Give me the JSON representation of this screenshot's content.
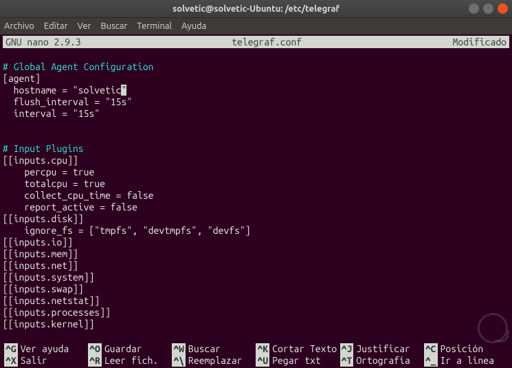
{
  "window": {
    "title": "solvetic@solvetic-Ubuntu: /etc/telegraf"
  },
  "menubar": {
    "items": [
      "Archivo",
      "Editar",
      "Ver",
      "Buscar",
      "Terminal",
      "Ayuda"
    ]
  },
  "nano": {
    "version": "GNU nano 2.9.3",
    "filename": "telegraf.conf",
    "status": "Modificado"
  },
  "editor": {
    "lines": [
      {
        "text": "",
        "cls": ""
      },
      {
        "text": "# Global Agent Configuration",
        "cls": "comment"
      },
      {
        "text": "[agent]",
        "cls": ""
      },
      {
        "text": "  hostname = \"solvetic",
        "cls": "",
        "cursor_after": "\""
      },
      {
        "text": "  flush_interval = \"15s\"",
        "cls": ""
      },
      {
        "text": "  interval = \"15s\"",
        "cls": ""
      },
      {
        "text": "",
        "cls": ""
      },
      {
        "text": "",
        "cls": ""
      },
      {
        "text": "# Input Plugins",
        "cls": "comment"
      },
      {
        "text": "[[inputs.cpu]]",
        "cls": ""
      },
      {
        "text": "    percpu = true",
        "cls": ""
      },
      {
        "text": "    totalcpu = true",
        "cls": ""
      },
      {
        "text": "    collect_cpu_time = false",
        "cls": ""
      },
      {
        "text": "    report_active = false",
        "cls": ""
      },
      {
        "text": "[[inputs.disk]]",
        "cls": ""
      },
      {
        "text": "    ignore_fs = [\"tmpfs\", \"devtmpfs\", \"devfs\"]",
        "cls": ""
      },
      {
        "text": "[[inputs.io]]",
        "cls": ""
      },
      {
        "text": "[[inputs.mem]]",
        "cls": ""
      },
      {
        "text": "[[inputs.net]]",
        "cls": ""
      },
      {
        "text": "[[inputs.system]]",
        "cls": ""
      },
      {
        "text": "[[inputs.swap]]",
        "cls": ""
      },
      {
        "text": "[[inputs.netstat]]",
        "cls": ""
      },
      {
        "text": "[[inputs.processes]]",
        "cls": ""
      },
      {
        "text": "[[inputs.kernel]]",
        "cls": ""
      },
      {
        "text": "",
        "cls": ""
      }
    ]
  },
  "shortcuts": {
    "row1": [
      {
        "key": "^G",
        "label": "Ver ayuda"
      },
      {
        "key": "^O",
        "label": "Guardar"
      },
      {
        "key": "^W",
        "label": "Buscar"
      },
      {
        "key": "^K",
        "label": "Cortar Texto"
      },
      {
        "key": "^J",
        "label": "Justificar"
      },
      {
        "key": "^C",
        "label": "Posición"
      }
    ],
    "row2": [
      {
        "key": "^X",
        "label": "Salir"
      },
      {
        "key": "^R",
        "label": "Leer fich."
      },
      {
        "key": "^\\",
        "label": "Reemplazar"
      },
      {
        "key": "^U",
        "label": "Pegar txt"
      },
      {
        "key": "^T",
        "label": "Ortografía"
      },
      {
        "key": "^_",
        "label": "Ir a línea"
      }
    ]
  }
}
